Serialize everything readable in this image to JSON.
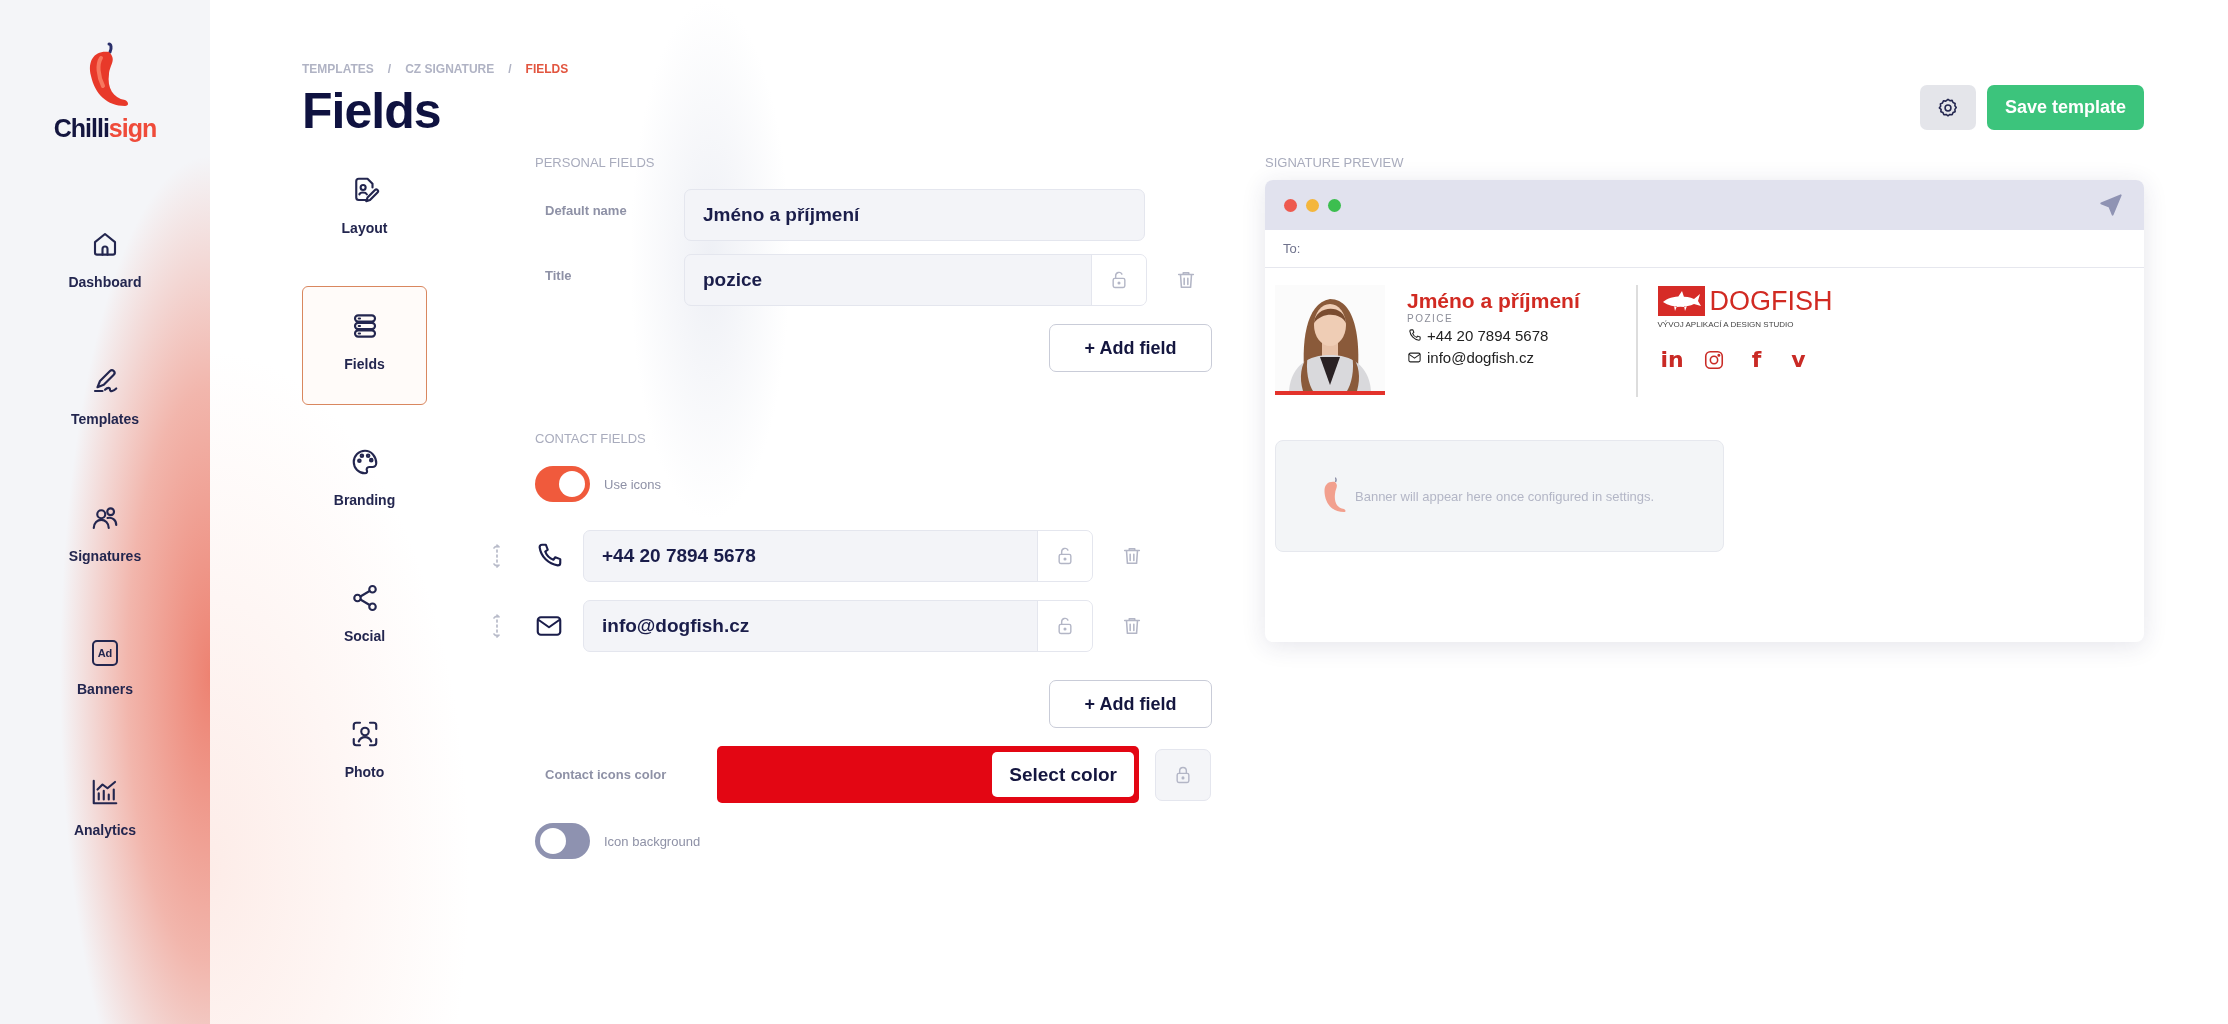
{
  "logo": {
    "part_1": "Chilli",
    "part_2": "sign"
  },
  "sidebar": {
    "items": [
      {
        "label": "Dashboard",
        "kind": "home"
      },
      {
        "label": "Templates",
        "kind": "pen"
      },
      {
        "label": "Signatures",
        "kind": "users"
      },
      {
        "label": "Banners",
        "kind": "ad",
        "icon_text": "Ad"
      },
      {
        "label": "Analytics",
        "kind": "chart"
      }
    ]
  },
  "breadcrumb": [
    {
      "kind": "link",
      "label": "TEMPLATES",
      "selected": false
    },
    {
      "kind": "separator",
      "label": "/"
    },
    {
      "kind": "link",
      "label": "CZ SIGNATURE",
      "selected": false
    },
    {
      "kind": "separator",
      "label": "/"
    },
    {
      "kind": "link",
      "label": "FIELDS",
      "selected": true
    }
  ],
  "page_title": "Fields",
  "actions": {
    "save_button": "Save template"
  },
  "subnav": [
    {
      "label": "Layout",
      "kind": "layout",
      "selected": false
    },
    {
      "label": "Fields",
      "kind": "fields",
      "selected": true
    },
    {
      "label": "Branding",
      "kind": "palette",
      "selected": false
    },
    {
      "label": "Social",
      "kind": "share",
      "selected": false
    },
    {
      "label": "Photo",
      "selected": false
    }
  ],
  "personal_fields": {
    "heading": "PERSONAL FIELDS",
    "rows": [
      {
        "label": "Default name",
        "value": "Jméno a příjmení",
        "kind": "plain"
      },
      {
        "label": "Title",
        "value": "pozice",
        "kind": "removable",
        "locked": false
      }
    ],
    "add_button": "+ Add field"
  },
  "contact_fields": {
    "heading": "CONTACT FIELDS",
    "use_icons": {
      "label": "Use icons",
      "on": true
    },
    "rows": [
      {
        "kind": "phone",
        "value": "+44 20 7894 5678",
        "locked": false
      },
      {
        "kind": "mail",
        "value": "info@dogfish.cz",
        "locked": false
      }
    ],
    "add_button": "+ Add field",
    "icons_color": {
      "label": "Contact icons color",
      "color": "#e30613",
      "button": "Select color",
      "locked": true
    },
    "icon_background": {
      "label": "Icon background",
      "on": false
    }
  },
  "preview": {
    "heading": "SIGNATURE PREVIEW",
    "to_label": "To:",
    "signature": {
      "name": "Jméno a příjmení",
      "title": "POZICE",
      "phone": "+44 20 7894 5678",
      "email": "info@dogfish.cz",
      "company": "DOGFISH",
      "tagline": "VÝVOJ APLIKACÍ A DESIGN STUDIO",
      "social": [
        {
          "kind": "glyph",
          "label": "in"
        },
        {
          "kind": "camera"
        },
        {
          "kind": "glyph",
          "label": "f"
        },
        {
          "kind": "glyph",
          "label": "v"
        }
      ]
    },
    "banner_text": "Banner will appear here once configured in settings."
  }
}
